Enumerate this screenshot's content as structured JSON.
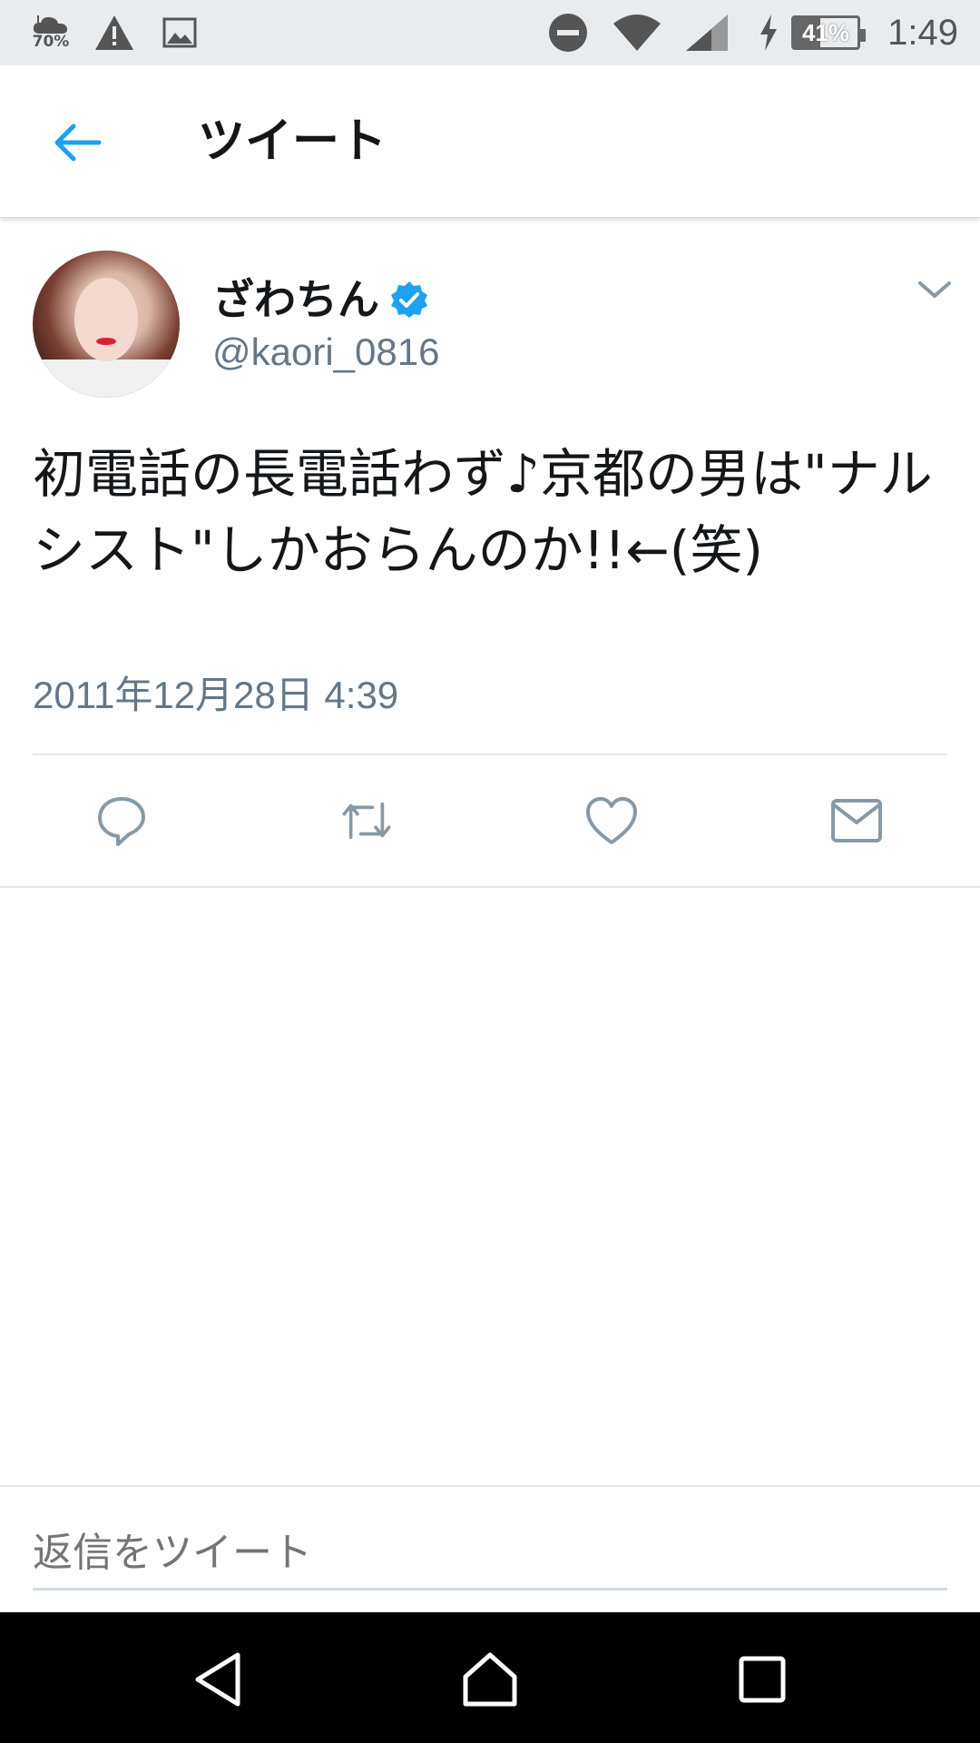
{
  "status_bar": {
    "weather_percent": "70%",
    "battery_percent": "41%",
    "time": "1:49",
    "icons": [
      "weather-icon",
      "warning-icon",
      "image-icon",
      "do-not-disturb-icon",
      "wifi-icon",
      "signal-icon",
      "charging-icon",
      "battery-icon"
    ]
  },
  "header": {
    "title": "ツイート",
    "back_icon": "back-arrow-icon"
  },
  "tweet": {
    "display_name": "ざわちん",
    "verified": true,
    "handle": "@kaori_0816",
    "text": "初電話の長電話わず♪京都の男は\"ナルシスト\"しかおらんのか!!←(笑)",
    "timestamp": "2011年12月28日 4:39",
    "actions": [
      "reply-icon",
      "retweet-icon",
      "like-icon",
      "direct-message-icon"
    ]
  },
  "reply": {
    "placeholder": "返信をツイート"
  },
  "colors": {
    "accent": "#1da1f2",
    "secondary_text": "#657786",
    "status_bar_bg": "#e9ecef",
    "nav_bar_bg": "#000000"
  }
}
